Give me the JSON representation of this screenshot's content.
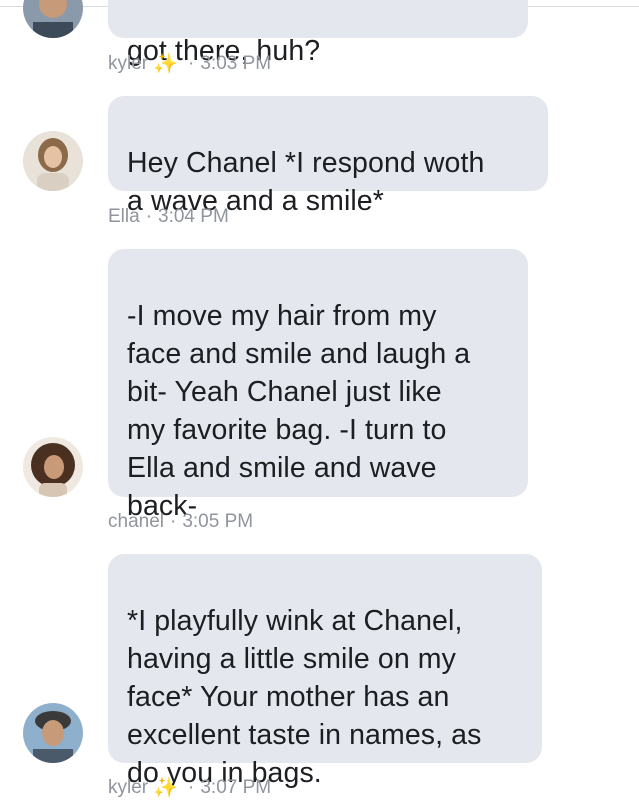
{
  "messages": [
    {
      "text": "got there, huh?",
      "author": "kyler",
      "author_icon": "sparkles-icon",
      "sparkle": "✨",
      "time": "3:03 PM"
    },
    {
      "text": "Hey Chanel *I respond woth\na wave and a smile*",
      "author": "Ella",
      "time": "3:04 PM"
    },
    {
      "text": "-I move my hair from my\nface and smile and laugh a\nbit- Yeah Chanel just like\nmy favorite bag. -I turn to\nElla and smile and wave\nback-",
      "author": "chanel",
      "time": "3:05 PM"
    },
    {
      "text": "*I playfully wink at Chanel,\nhaving a little smile on my\nface* Your mother has an\nexcellent taste in names, as\ndo you in bags.",
      "author": "kyler",
      "author_icon": "sparkles-icon",
      "sparkle": "✨",
      "time": "3:07 PM"
    }
  ],
  "separator": "·",
  "colors": {
    "bubble": "#e4e8ee",
    "meta_text": "#90949c",
    "sparkle": "#f7c64a"
  }
}
